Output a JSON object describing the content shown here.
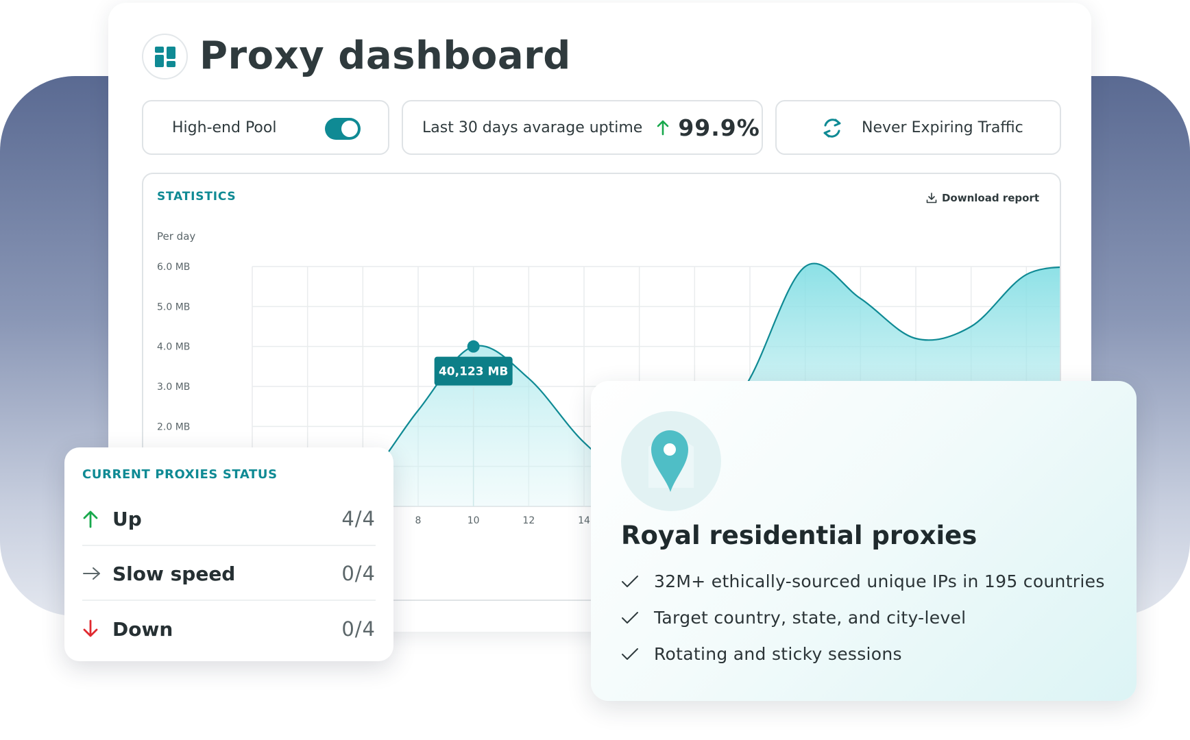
{
  "header": {
    "title": "Proxy dashboard",
    "logo_icon": "dashboard-grid-icon"
  },
  "pills": {
    "pool_label": "High-end Pool",
    "pool_toggle_on": true,
    "uptime_label": "Last 30 days avarage uptime",
    "uptime_value": "99.9%",
    "traffic_label": "Never Expiring Traffic"
  },
  "statistics": {
    "title": "STATISTICS",
    "download_label": "Download report",
    "per_day_label": "Per day",
    "tooltip": "40,123 MB"
  },
  "chart_data": {
    "type": "area",
    "title": "STATISTICS",
    "ylabel": "Per day",
    "y_tick_labels": [
      "6.0 MB",
      "5.0 MB",
      "4.0 MB",
      "3.0 MB",
      "2.0 MB"
    ],
    "y_ticks": [
      6,
      5,
      4,
      3,
      2
    ],
    "x_tick_labels": [
      "8",
      "10",
      "12",
      "14"
    ],
    "x_ticks": [
      8,
      10,
      12,
      14
    ],
    "xlim": [
      2,
      32
    ],
    "ylim": [
      0,
      6.0
    ],
    "grid": true,
    "series": [
      {
        "x": [
          2,
          4,
          6,
          8,
          10,
          12,
          14,
          16,
          18,
          20,
          22,
          24,
          26,
          28,
          30,
          32
        ],
        "y": [
          0.1,
          0.1,
          0.6,
          2.4,
          4.0,
          3.2,
          1.6,
          0.6,
          1.0,
          3.2,
          6.0,
          5.2,
          4.2,
          4.5,
          5.8,
          6.0
        ]
      }
    ],
    "highlight": {
      "x": 10,
      "y": 4.0,
      "label": "40,123 MB"
    }
  },
  "colors": {
    "accent": "#0f8a94",
    "area_fill": "#8fe3e8",
    "up": "#18a84c",
    "down": "#e0292f"
  },
  "proxies_status": {
    "title": "CURRENT PROXIES STATUS",
    "rows": [
      {
        "label": "Up",
        "count": "4/4",
        "icon": "arrow-up-icon"
      },
      {
        "label": "Slow speed",
        "count": "0/4",
        "icon": "arrow-right-icon"
      },
      {
        "label": "Down",
        "count": "0/4",
        "icon": "arrow-down-icon"
      }
    ]
  },
  "promo": {
    "title": "Royal residential proxies",
    "icon": "location-pin-icon",
    "features": [
      "32M+ ethically-sourced unique IPs in 195 countries",
      "Target country, state, and city-level",
      "Rotating and sticky sessions"
    ]
  }
}
